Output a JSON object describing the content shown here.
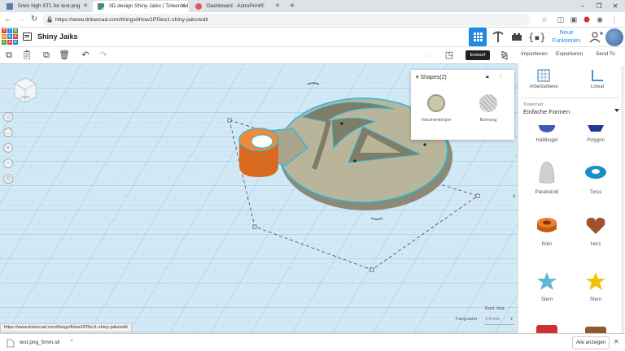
{
  "browser": {
    "tabs": [
      {
        "title": "5mm high STL for test.png",
        "active": false
      },
      {
        "title": "3D design Shiny Jaiks | Tinkercad",
        "active": true
      },
      {
        "title": "Dashboard · AstroPrint®",
        "active": false
      }
    ],
    "url": "https://www.tinkercad.com/things/lHow1Pf3ex1-shiny-jaiks/edit"
  },
  "app": {
    "logo_letters": [
      "TIN",
      "KER",
      "CAD"
    ],
    "design_title": "Shiny Jaiks",
    "new_features": "Neue Funktionen",
    "tooltip": "Entwurf"
  },
  "toolbar": {
    "import": "Importieren",
    "export": "Exportieren",
    "send": "Send To"
  },
  "viewcube": {
    "label": "LINKS"
  },
  "shapes_panel": {
    "title": "Shapes(2)",
    "solid": "Volumenkörper",
    "hole": "Bohrung"
  },
  "right_panel": {
    "workplane": "Arbeitsebene",
    "ruler": "Lineal",
    "library_label": "Tinkercad",
    "library_name": "Einfache Formen",
    "shapes": [
      {
        "label": "Halbkugel"
      },
      {
        "label": "Polygon"
      },
      {
        "label": "Paraboloid"
      },
      {
        "label": "Torus"
      },
      {
        "label": "Rohr"
      },
      {
        "label": "Herz"
      },
      {
        "label": "Stern"
      },
      {
        "label": "Stern"
      }
    ]
  },
  "grid": {
    "edit_grid": "Rast. bea.",
    "snap_label": "Fangraster",
    "snap_value": "1.0 mm"
  },
  "status_url": "https://www.tinkercad.com/things/lHow1Pf3ex1-shiny-jaiks/edit",
  "download": {
    "file": "test.png_5mm.stl",
    "show_all": "Alle anzeigen"
  },
  "colors": {
    "accent": "#1e88e5",
    "grid_bg": "#cfe6f4",
    "model": "#b8b49a",
    "cylinder": "#e87b2a"
  }
}
